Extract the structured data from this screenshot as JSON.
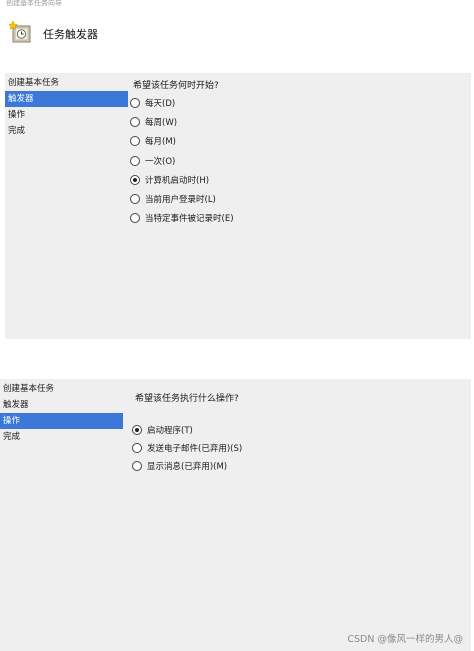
{
  "window": {
    "title_cut": "创建基本任务向导",
    "header_title": "任务触发器"
  },
  "trigger_page": {
    "sidebar": [
      {
        "label": "创建基本任务",
        "active": false
      },
      {
        "label": "触发器",
        "active": true
      },
      {
        "label": "操作",
        "active": false
      },
      {
        "label": "完成",
        "active": false
      }
    ],
    "question": "希望该任务何时开始?",
    "options": [
      {
        "label": "每天(D)",
        "checked": false
      },
      {
        "label": "每周(W)",
        "checked": false
      },
      {
        "label": "每月(M)",
        "checked": false
      },
      {
        "label": "一次(O)",
        "checked": false
      },
      {
        "label": "计算机启动时(H)",
        "checked": true
      },
      {
        "label": "当前用户登录时(L)",
        "checked": false
      },
      {
        "label": "当特定事件被记录时(E)",
        "checked": false
      }
    ]
  },
  "action_page": {
    "sidebar": [
      {
        "label": "创建基本任务",
        "active": false
      },
      {
        "label": "触发器",
        "active": false
      },
      {
        "label": "操作",
        "active": true
      },
      {
        "label": "完成",
        "active": false
      }
    ],
    "question": "希望该任务执行什么操作?",
    "options": [
      {
        "label": "启动程序(T)",
        "checked": true
      },
      {
        "label": "发送电子邮件(已弃用)(S)",
        "checked": false
      },
      {
        "label": "显示消息(已弃用)(M)",
        "checked": false
      }
    ]
  },
  "watermark": "CSDN @像风一样的男人@",
  "colors": {
    "selection": "#3c78d8",
    "panel": "#efefef"
  },
  "icons": {
    "wizard": "task-wizard-icon"
  }
}
